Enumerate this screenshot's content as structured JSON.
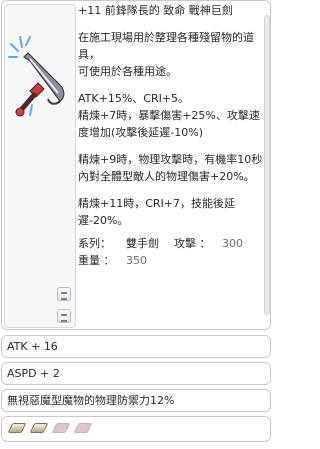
{
  "item": {
    "title": "+11 前鋒隊長的 致命 戰神巨劍",
    "description": "在施工現場用於整理各種殘留物的道具，\n可使用於各種用途。",
    "effects": [
      "ATK+15%、CRI+5。\n精煉+7時，暴擊傷害+25%、攻擊速度增加(攻擊後延遲-10%)",
      "精煉+9時，物理攻擊時，有機率10秒內對全體型敵人的物理傷害+20%。",
      "精煉+11時，CRI+7，技能後延遲-20%。"
    ],
    "series_label": "系列：",
    "series_value": "雙手劍",
    "attack_label": "攻擊 ：",
    "attack_value": "300",
    "weight_label": "重量 ：",
    "weight_value": "350"
  },
  "options": [
    "ATK + 16",
    "ASPD + 2",
    "無視惡魔型魔物的物理防禦力12%"
  ],
  "slots": [
    "filled",
    "filled",
    "empty",
    "empty"
  ],
  "colors": {
    "border": "#c9c9cf",
    "slot_filled": "#b9a98b",
    "slot_empty": "#d9c7cc"
  },
  "icons": {
    "item": "sword-icon",
    "expand": "expand-icon"
  }
}
